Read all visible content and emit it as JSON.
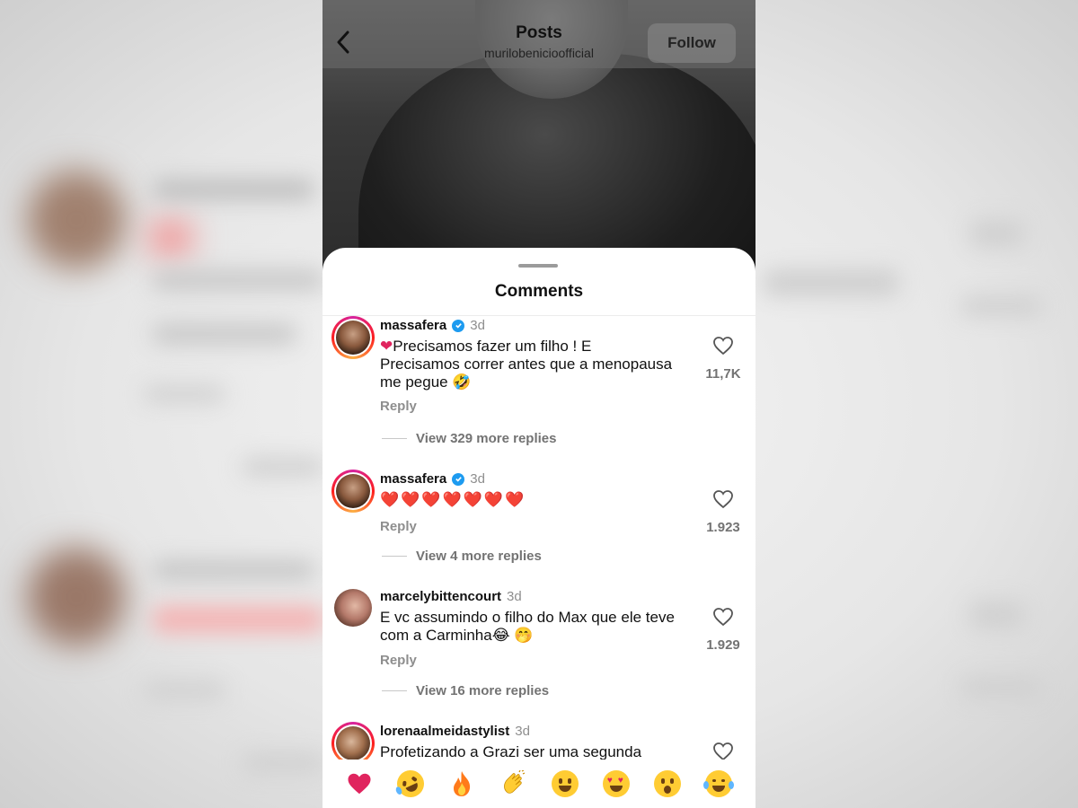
{
  "header": {
    "title": "Posts",
    "subtitle": "murilobenicioofficial",
    "follow_label": "Follow"
  },
  "sheet": {
    "title": "Comments"
  },
  "comments": [
    {
      "username": "massafera",
      "verified": true,
      "time": "3d",
      "text_line1": "Precisamos fazer um filho ! E",
      "text_line2": "Precisamos correr antes que a menopausa",
      "text_line3": "me pegue",
      "like_count": "11,7K",
      "reply_label": "Reply",
      "view_replies": "View 329 more replies"
    },
    {
      "username": "massafera",
      "verified": true,
      "time": "3d",
      "text": "❤️❤️❤️❤️❤️❤️❤️",
      "like_count": "1.923",
      "reply_label": "Reply",
      "view_replies": "View 4 more replies"
    },
    {
      "username": "marcelybittencourt",
      "verified": false,
      "time": "3d",
      "text_line1": "E vc assumindo o filho do Max que ele teve",
      "text_line2": "com a Carminha",
      "like_count": "1.929",
      "reply_label": "Reply",
      "view_replies": "View 16 more replies"
    },
    {
      "username": "lorenaalmeidastylist",
      "verified": false,
      "time": "3d",
      "text": "Profetizando a Grazi ser uma segunda"
    }
  ],
  "reactions": [
    "heart",
    "rofl",
    "fire",
    "clap",
    "yum",
    "heart-eyes",
    "surprised",
    "joy"
  ],
  "colors": {
    "accent_blue": "#1d9bf0",
    "heart_red": "#e0245e",
    "muted_gray": "#8e8e8e"
  }
}
